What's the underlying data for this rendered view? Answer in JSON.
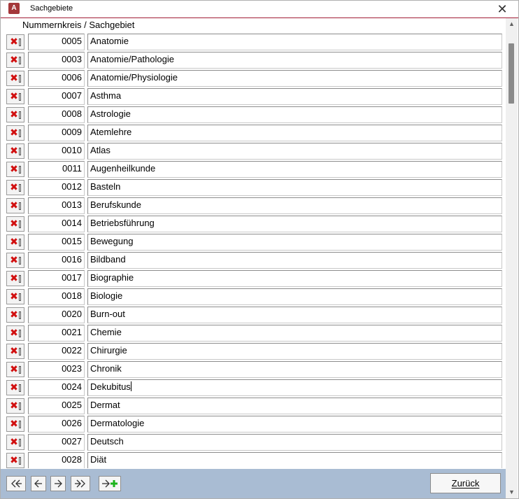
{
  "window": {
    "title": "Sachgebiete",
    "close_glyph": "✕"
  },
  "header": {
    "label": "Nummernkreis / Sachgebiet"
  },
  "rows": [
    {
      "num": "0005",
      "name": "Anatomie"
    },
    {
      "num": "0003",
      "name": "Anatomie/Pathologie"
    },
    {
      "num": "0006",
      "name": "Anatomie/Physiologie"
    },
    {
      "num": "0007",
      "name": "Asthma"
    },
    {
      "num": "0008",
      "name": "Astrologie"
    },
    {
      "num": "0009",
      "name": "Atemlehre"
    },
    {
      "num": "0010",
      "name": "Atlas"
    },
    {
      "num": "0011",
      "name": "Augenheilkunde"
    },
    {
      "num": "0012",
      "name": "Basteln"
    },
    {
      "num": "0013",
      "name": "Berufskunde"
    },
    {
      "num": "0014",
      "name": "Betriebsführung"
    },
    {
      "num": "0015",
      "name": "Bewegung"
    },
    {
      "num": "0016",
      "name": "Bildband"
    },
    {
      "num": "0017",
      "name": "Biographie"
    },
    {
      "num": "0018",
      "name": "Biologie"
    },
    {
      "num": "0020",
      "name": "Burn-out"
    },
    {
      "num": "0021",
      "name": "Chemie"
    },
    {
      "num": "0022",
      "name": "Chirurgie"
    },
    {
      "num": "0023",
      "name": "Chronik"
    },
    {
      "num": "0024",
      "name": "Dekubitus",
      "focused": true
    },
    {
      "num": "0025",
      "name": "Dermat"
    },
    {
      "num": "0026",
      "name": "Dermatologie"
    },
    {
      "num": "0027",
      "name": "Deutsch"
    },
    {
      "num": "0028",
      "name": "Diät"
    }
  ],
  "row_icons": {
    "delete": "delete-record-icon"
  },
  "footer": {
    "back_label": "Zurück",
    "nav_icons": [
      "first-record-icon",
      "previous-record-icon",
      "next-record-icon",
      "last-record-icon",
      "new-record-icon"
    ]
  },
  "colors": {
    "footer_bg": "#a9bcd3",
    "delete_red": "#d10f0f",
    "new_green": "#1bb31b",
    "title_accent": "#a21d36"
  }
}
